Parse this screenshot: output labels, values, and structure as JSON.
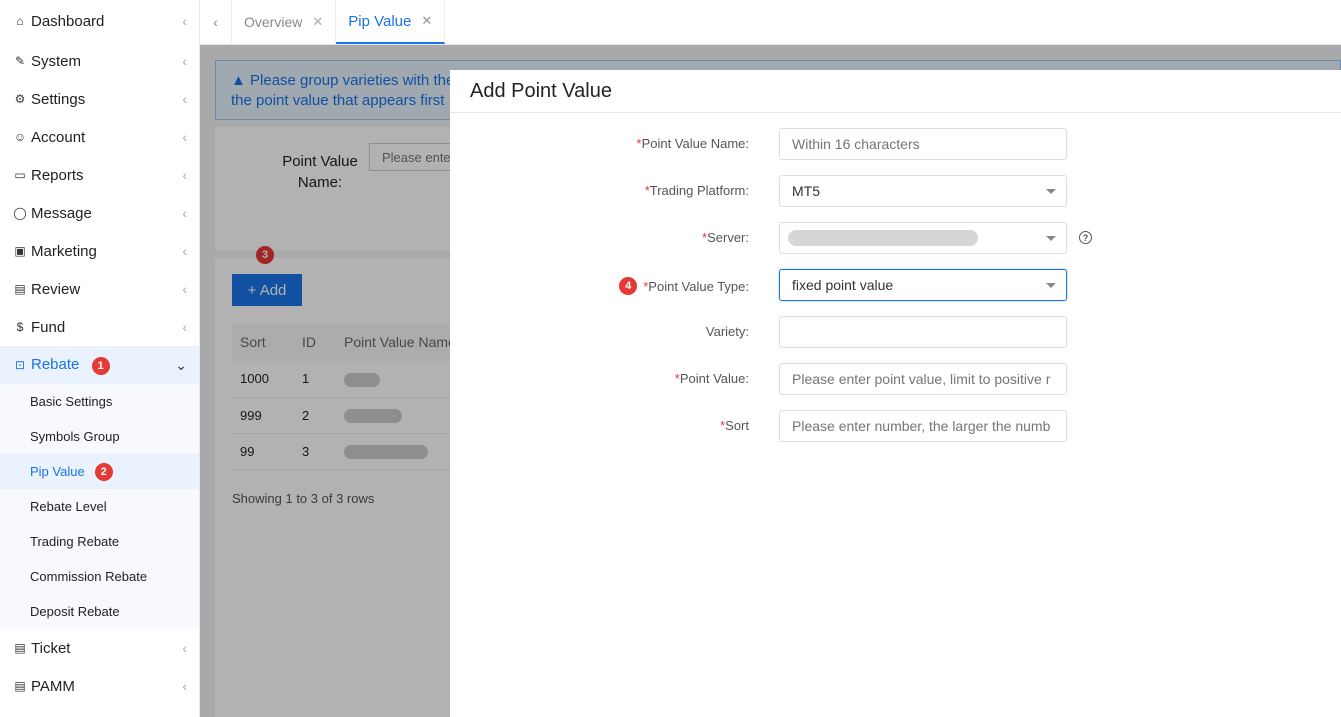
{
  "sidebar": {
    "items": [
      {
        "label": "Dashboard",
        "icon": "home-icon",
        "glyph": "⌂"
      },
      {
        "label": "System",
        "icon": "wrench-icon",
        "glyph": "✎"
      },
      {
        "label": "Settings",
        "icon": "gear-icon",
        "glyph": "⚙"
      },
      {
        "label": "Account",
        "icon": "user-icon",
        "glyph": "☺"
      },
      {
        "label": "Reports",
        "icon": "monitor-icon",
        "glyph": "▭"
      },
      {
        "label": "Message",
        "icon": "chat-icon",
        "glyph": "◯"
      },
      {
        "label": "Marketing",
        "icon": "gift-icon",
        "glyph": "▣"
      },
      {
        "label": "Review",
        "icon": "review-icon",
        "glyph": "▤"
      },
      {
        "label": "Fund",
        "icon": "dollar-icon",
        "glyph": "$"
      },
      {
        "label": "Rebate",
        "icon": "rebate-icon",
        "glyph": "⊡",
        "badge": "1"
      },
      {
        "label": "Ticket",
        "icon": "ticket-icon",
        "glyph": "▤"
      },
      {
        "label": "PAMM",
        "icon": "pamm-icon",
        "glyph": "▤"
      }
    ],
    "rebate_sub": [
      {
        "label": "Basic Settings"
      },
      {
        "label": "Symbols Group"
      },
      {
        "label": "Pip Value",
        "badge": "2"
      },
      {
        "label": "Rebate Level"
      },
      {
        "label": "Trading Rebate"
      },
      {
        "label": "Commission Rebate"
      },
      {
        "label": "Deposit Rebate"
      }
    ]
  },
  "tabs": [
    {
      "label": "Overview",
      "close": "✕"
    },
    {
      "label": "Pip Value",
      "close": "✕"
    }
  ],
  "alert": {
    "icon": "warning-icon",
    "line1": "Please group varieties with the",
    "line2": "the point value that appears first"
  },
  "search": {
    "label": "Point Value Name:",
    "placeholder": "Please enter"
  },
  "table": {
    "add_label": "+ Add",
    "add_badge": "3",
    "headers": [
      "Sort",
      "ID",
      "Point Value Name"
    ],
    "rows": [
      {
        "sort": "1000",
        "id": "1"
      },
      {
        "sort": "999",
        "id": "2"
      },
      {
        "sort": "99",
        "id": "3"
      }
    ],
    "footer": "Showing 1 to 3 of 3 rows"
  },
  "dialog": {
    "title": "Add Point Value",
    "fields": {
      "name": {
        "label": "Point Value Name:",
        "placeholder": "Within 16 characters",
        "required": true
      },
      "platform": {
        "label": "Trading Platform:",
        "value": "MT5",
        "required": true
      },
      "server": {
        "label": "Server:",
        "required": true
      },
      "type": {
        "label": "Point Value Type:",
        "value": "fixed point value",
        "required": true,
        "badge": "4"
      },
      "variety": {
        "label": "Variety:",
        "value": ""
      },
      "point_value": {
        "label": "Point Value:",
        "placeholder": "Please enter point value, limit to positive r",
        "required": true
      },
      "sort": {
        "label": "Sort",
        "placeholder": "Please enter number, the larger the numb",
        "required": true
      }
    }
  },
  "colors": {
    "accent": "#1a73e8",
    "badge": "#e53935"
  }
}
